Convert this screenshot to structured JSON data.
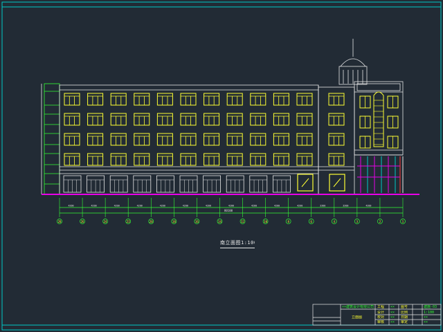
{
  "drawing": {
    "caption": "南立面图1:100",
    "total_dimension": "80100",
    "dimension_labels": [
      "4200",
      "4200",
      "4200",
      "4200",
      "4200",
      "4200",
      "4200",
      "4200",
      "4200",
      "4200",
      "4200",
      "3300",
      "3300",
      "4200"
    ],
    "axis_labels": [
      "28",
      "26",
      "24",
      "22",
      "20",
      "18",
      "16",
      "14",
      "12",
      "10",
      "8",
      "6",
      "4",
      "3",
      "2",
      "1"
    ]
  },
  "title_block": {
    "company": "××建筑设计有限公司",
    "drawing_name": "立面图",
    "labels": [
      "工程",
      "图号",
      "设计",
      "比例",
      "校对",
      "日期",
      "审核",
      "审定"
    ],
    "values": [
      "××",
      "建施-03",
      "××",
      "1:100",
      "××",
      "××",
      "××",
      "××"
    ]
  },
  "colors": {
    "background": "#222b35",
    "line": "#e8e8e8",
    "window": "#ffff33",
    "dimension": "#33ff33",
    "ground": "#e800e8",
    "frame": "#00c8c8",
    "accent_red": "#ff3333"
  }
}
